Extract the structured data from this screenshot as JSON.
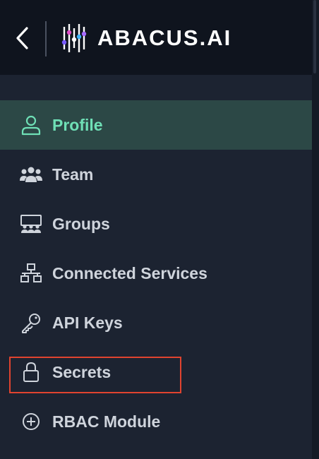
{
  "header": {
    "back_icon": "chevron-left-icon",
    "logo_text": "ABACUS.AI",
    "logo_mark": "abacus-logo-mark"
  },
  "sidebar": {
    "items": [
      {
        "label": "Profile",
        "icon": "user-icon",
        "active": true
      },
      {
        "label": "Team",
        "icon": "team-icon",
        "active": false
      },
      {
        "label": "Groups",
        "icon": "groups-icon",
        "active": false
      },
      {
        "label": "Connected Services",
        "icon": "network-icon",
        "active": false
      },
      {
        "label": "API Keys",
        "icon": "key-icon",
        "active": false
      },
      {
        "label": "Secrets",
        "icon": "lock-icon",
        "active": false
      },
      {
        "label": "RBAC Module",
        "icon": "plus-circle-icon",
        "active": false
      }
    ]
  },
  "colors": {
    "active_accent": "#6fe0b6",
    "active_background": "#2c4846",
    "highlight_border": "#e0432f"
  }
}
